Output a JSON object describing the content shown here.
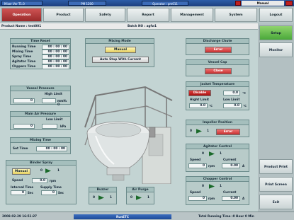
{
  "topbar": {
    "left_info": "Mixer Ver T1.0",
    "middle_info": "PM 1200",
    "operator": "Operator : pm011",
    "mode": "Manual"
  },
  "tabs": [
    "Operation",
    "Product",
    "Safety",
    "Report",
    "Management",
    "System"
  ],
  "logout": "Logout",
  "info": {
    "product_label": "Product Name : test001",
    "batch_label": "Batch NO : agfw1"
  },
  "sidebar": [
    "Setup",
    "Monitor",
    "Product Print",
    "Print Screen",
    "Exit"
  ],
  "timer": {
    "title": "Time Reset",
    "rows": [
      {
        "label": "Running Time",
        "value": "00 : 00 : 00"
      },
      {
        "label": "Mixing Time",
        "value": "00 : 00 : 00"
      },
      {
        "label": "Spray Time",
        "value": "00 : 00 : 00"
      },
      {
        "label": "Agitator Time",
        "value": "00 : 00 : 00"
      },
      {
        "label": "Chppers Time",
        "value": "00 : 00 : 00"
      }
    ]
  },
  "vessel_pressure": {
    "title": "Vessel Pressure",
    "high_limit": "High Limit",
    "value": "0",
    "unit": "mmH₂ O"
  },
  "air_pressure": {
    "title": "Main Air Pressure",
    "low_limit": "Low Limit",
    "value": "0",
    "unit": "kPa"
  },
  "mixing_time": {
    "title": "Mixing Time",
    "set_time_label": "Set Time",
    "value": "00 : 00 : 00"
  },
  "binder_spray": {
    "title": "Binder Spray",
    "manual": "Manual",
    "zero": "0",
    "one": "1",
    "speed_label": "Speed",
    "speed_value": "0.0",
    "speed_unit": "rpm",
    "interval_label": "Interval Time",
    "supply_label": "Supply Time",
    "interval_value": "0",
    "supply_value": "0",
    "sec": "Sec"
  },
  "mixing_mode": {
    "title": "Mixing Mode",
    "manual": "Manual",
    "auto": "Auto Stop With Current"
  },
  "buzzer": {
    "title": "Buzzer",
    "zero": "0",
    "one": "1"
  },
  "air_purge": {
    "title": "Air Purge",
    "zero": "0",
    "one": "1"
  },
  "discharge": {
    "title": "Discharge Chute",
    "button": "Error"
  },
  "vessel_cap": {
    "title": "Vessel Cap",
    "button": "Close"
  },
  "jacket": {
    "title": "Jacket Temperature",
    "button": "Disable",
    "value": "0.0",
    "unit": "℃",
    "high_label": "Hight Limit",
    "low_label": "Low Limit",
    "high_value": "0.0",
    "low_value": "0.0"
  },
  "impeller": {
    "title": "Impeller Position",
    "zero": "0",
    "one": "1",
    "button": "Error"
  },
  "agitator": {
    "title": "Agitator Control",
    "zero": "0",
    "one": "1",
    "speed_label": "Speed",
    "current_label": "Current",
    "speed_value": "0",
    "speed_unit": "rpm",
    "current_value": "0.00",
    "current_unit": "A"
  },
  "chopper": {
    "title": "Chopper Control",
    "zero": "0",
    "one": "1",
    "speed_label": "Speed",
    "current_label": "Current",
    "speed_value": "0",
    "speed_unit": "rpm",
    "current_value": "0.00",
    "current_unit": "A"
  },
  "status": {
    "datetime": "2008-02-29 16:51:27",
    "middle": "RunETC",
    "total": "Total Running Time :0 Hour 0 Min"
  }
}
